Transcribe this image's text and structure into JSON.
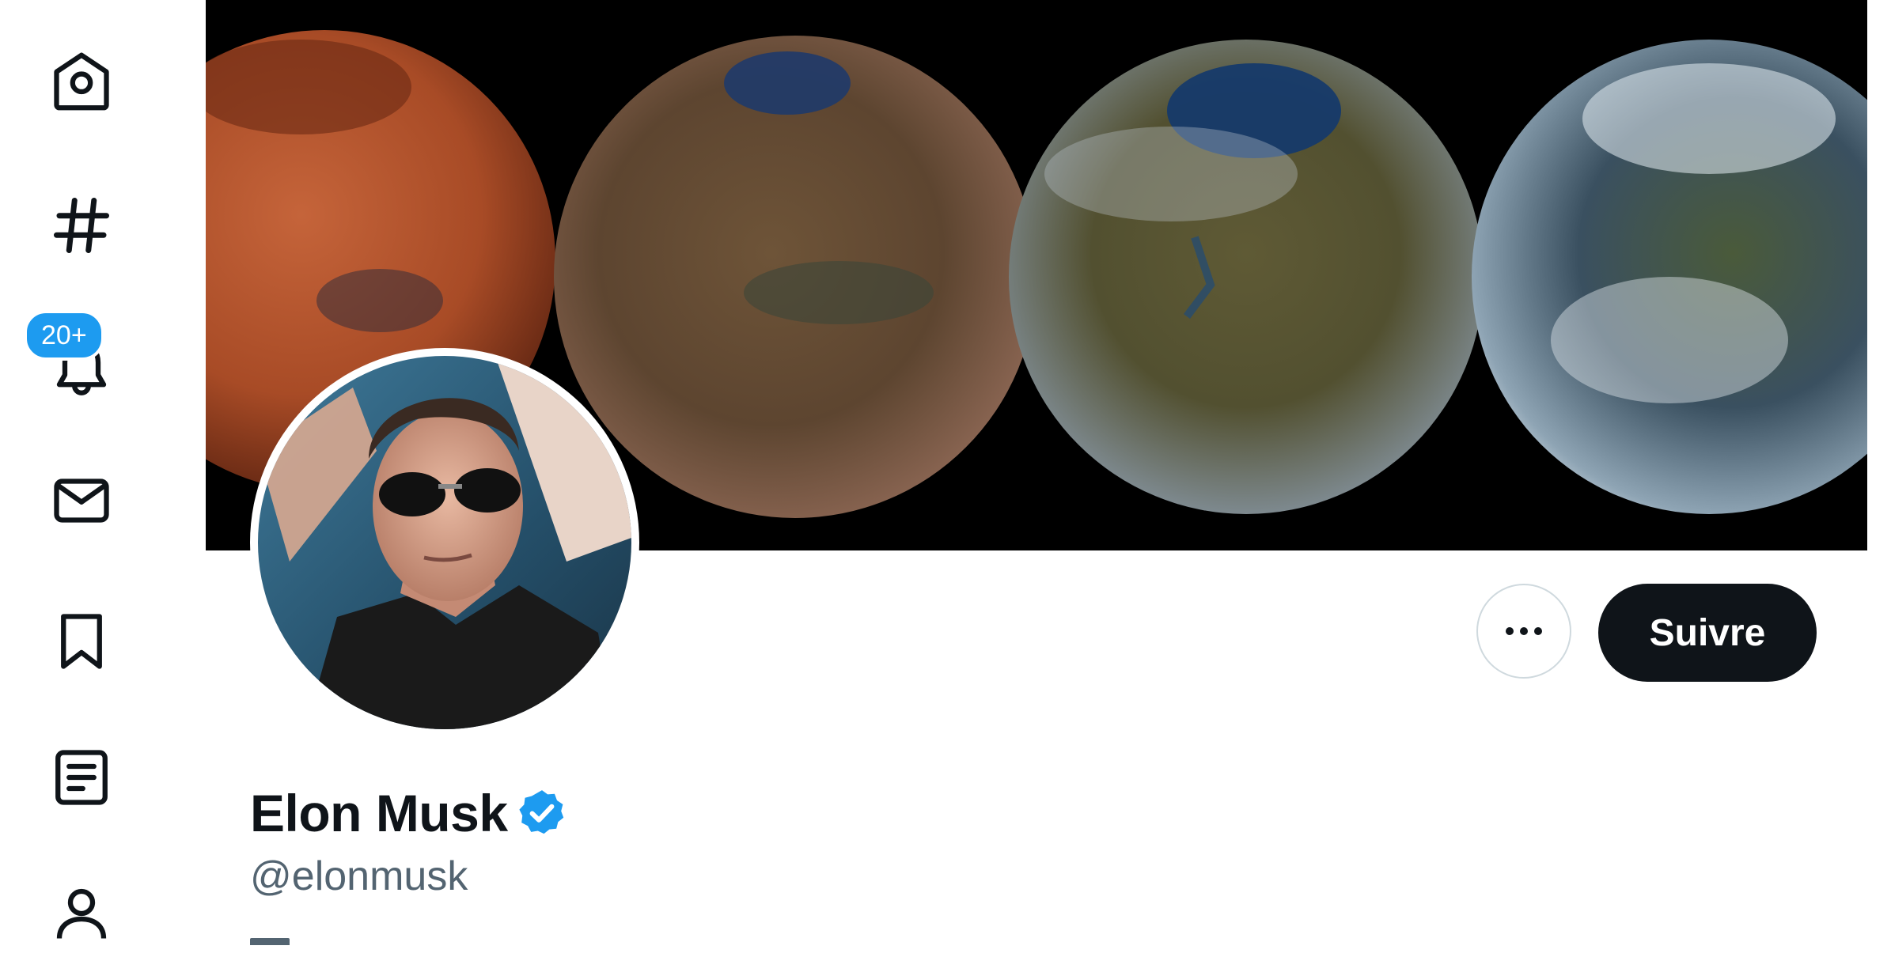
{
  "sidebar": {
    "items": [
      {
        "icon": "home-icon"
      },
      {
        "icon": "hashtag-icon"
      },
      {
        "icon": "bell-icon",
        "badge": "20+"
      },
      {
        "icon": "mail-icon"
      },
      {
        "icon": "bookmark-icon"
      },
      {
        "icon": "list-icon"
      },
      {
        "icon": "profile-icon"
      }
    ]
  },
  "profile": {
    "name": "Elon Musk",
    "handle": "@elonmusk",
    "verified": true,
    "follow_label": "Suivre",
    "more_icon": "more-icon"
  },
  "colors": {
    "accent": "#1d9bf0",
    "text": "#0f1419",
    "secondary": "#536471",
    "follow_bg": "#0f1419"
  }
}
